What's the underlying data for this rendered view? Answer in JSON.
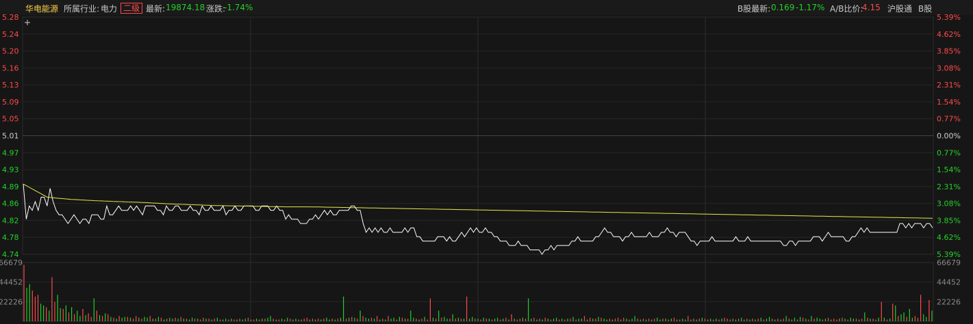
{
  "header": {
    "stock_name": "华电能源",
    "industry_label": "所属行业:",
    "industry_value": "电力",
    "level_badge": "二级",
    "latest_label": "最新:",
    "latest_value": "19874.18",
    "change_label": "涨跌:",
    "change_value": "-1.74%",
    "b_latest_label": "B股最新:",
    "b_latest_value": "0.169",
    "b_change_value": "-1.17%",
    "ab_ratio_label": "A/B比价:",
    "ab_ratio_value": "4.15",
    "hgt_label": "沪股通",
    "b_share_label": "B股"
  },
  "crosshair_icon": "plus-icon",
  "chart_data": {
    "type": "line",
    "title": "",
    "price_ticks": [
      "5.28",
      "5.24",
      "5.20",
      "5.16",
      "5.13",
      "5.09",
      "5.05",
      "5.01",
      "4.97",
      "4.93",
      "4.89",
      "4.86",
      "4.82",
      "4.78",
      "4.74"
    ],
    "pct_ticks": [
      "5.39%",
      "4.62%",
      "3.85%",
      "3.08%",
      "2.31%",
      "1.54%",
      "0.77%",
      "0.00%",
      "0.77%",
      "1.54%",
      "2.31%",
      "3.08%",
      "3.85%",
      "4.62%",
      "5.39%"
    ],
    "ylim": [
      4.74,
      5.28
    ],
    "reference_price": 5.01,
    "volume_ticks": [
      "66679",
      "44452",
      "22226"
    ],
    "volume_max": 66679,
    "colors": {
      "up": "#ff4a4a",
      "down": "#25d02a",
      "price_line": "#ffffff",
      "avg_line": "#e8e84a",
      "grid": "#2c2c2c"
    },
    "series": [
      {
        "role": "price",
        "values": [
          4.9,
          4.82,
          4.85,
          4.84,
          4.86,
          4.84,
          4.87,
          4.87,
          4.85,
          4.89,
          4.86,
          4.84,
          4.83,
          4.83,
          4.82,
          4.81,
          4.82,
          4.83,
          4.82,
          4.81,
          4.82,
          4.82,
          4.81,
          4.83,
          4.83,
          4.83,
          4.82,
          4.82,
          4.85,
          4.83,
          4.83,
          4.84,
          4.85,
          4.84,
          4.84,
          4.84,
          4.85,
          4.84,
          4.85,
          4.84,
          4.83,
          4.85,
          4.85,
          4.85,
          4.85,
          4.84,
          4.84,
          4.83,
          4.85,
          4.84,
          4.84,
          4.85,
          4.85,
          4.84,
          4.84,
          4.84,
          4.85,
          4.84,
          4.84,
          4.83,
          4.85,
          4.84,
          4.84,
          4.85,
          4.84,
          4.84,
          4.84,
          4.85,
          4.83,
          4.84,
          4.84,
          4.85,
          4.84,
          4.84,
          4.85,
          4.85,
          4.85,
          4.85,
          4.84,
          4.84,
          4.85,
          4.85,
          4.85,
          4.84,
          4.84,
          4.85,
          4.84,
          4.84,
          4.82,
          4.83,
          4.82,
          4.82,
          4.82,
          4.81,
          4.81,
          4.81,
          4.82,
          4.82,
          4.83,
          4.82,
          4.83,
          4.84,
          4.83,
          4.84,
          4.83,
          4.83,
          4.84,
          4.84,
          4.84,
          4.84,
          4.85,
          4.85,
          4.84,
          4.84,
          4.81,
          4.79,
          4.8,
          4.79,
          4.8,
          4.79,
          4.8,
          4.79,
          4.79,
          4.8,
          4.79,
          4.79,
          4.79,
          4.79,
          4.8,
          4.79,
          4.8,
          4.8,
          4.78,
          4.78,
          4.77,
          4.77,
          4.77,
          4.77,
          4.77,
          4.78,
          4.78,
          4.78,
          4.77,
          4.78,
          4.77,
          4.77,
          4.78,
          4.79,
          4.78,
          4.79,
          4.8,
          4.79,
          4.8,
          4.79,
          4.79,
          4.8,
          4.79,
          4.79,
          4.78,
          4.78,
          4.77,
          4.77,
          4.77,
          4.76,
          4.76,
          4.76,
          4.77,
          4.76,
          4.76,
          4.76,
          4.75,
          4.75,
          4.75,
          4.75,
          4.74,
          4.75,
          4.75,
          4.76,
          4.75,
          4.76,
          4.76,
          4.76,
          4.76,
          4.76,
          4.77,
          4.77,
          4.78,
          4.77,
          4.77,
          4.77,
          4.77,
          4.77,
          4.78,
          4.78,
          4.79,
          4.8,
          4.79,
          4.79,
          4.78,
          4.78,
          4.78,
          4.77,
          4.78,
          4.78,
          4.79,
          4.78,
          4.78,
          4.78,
          4.78,
          4.78,
          4.79,
          4.78,
          4.78,
          4.78,
          4.79,
          4.79,
          4.8,
          4.79,
          4.79,
          4.78,
          4.79,
          4.79,
          4.79,
          4.78,
          4.77,
          4.77,
          4.76,
          4.77,
          4.77,
          4.77,
          4.77,
          4.78,
          4.77,
          4.77,
          4.77,
          4.77,
          4.77,
          4.77,
          4.77,
          4.78,
          4.77,
          4.77,
          4.77,
          4.78,
          4.77,
          4.77,
          4.77,
          4.77,
          4.77,
          4.77,
          4.77,
          4.77,
          4.77,
          4.77,
          4.77,
          4.76,
          4.76,
          4.77,
          4.77,
          4.76,
          4.77,
          4.77,
          4.77,
          4.77,
          4.77,
          4.78,
          4.78,
          4.78,
          4.77,
          4.78,
          4.79,
          4.78,
          4.78,
          4.78,
          4.78,
          4.78,
          4.77,
          4.77,
          4.78,
          4.78,
          4.79,
          4.8,
          4.79,
          4.8,
          4.79,
          4.79,
          4.79,
          4.79,
          4.79,
          4.79,
          4.79,
          4.79,
          4.79,
          4.79,
          4.81,
          4.81,
          4.8,
          4.81,
          4.8,
          4.81,
          4.81,
          4.81,
          4.8,
          4.81,
          4.81,
          4.8
        ],
        "length_note": ""
      },
      {
        "role": "average",
        "values": [
          4.9,
          4.87,
          4.865,
          4.862,
          4.86,
          4.858,
          4.855,
          4.853,
          4.851,
          4.85,
          4.849,
          4.848,
          4.848,
          4.847,
          4.846,
          4.845,
          4.844,
          4.843,
          4.842,
          4.841,
          4.84,
          4.839,
          4.838,
          4.837,
          4.836,
          4.835,
          4.834,
          4.833,
          4.832,
          4.831,
          4.83,
          4.829,
          4.828,
          4.827,
          4.826,
          4.825,
          4.824,
          4.823,
          4.822
        ]
      }
    ],
    "volume": [
      64000,
      38000,
      42000,
      35000,
      28000,
      30000,
      20000,
      18000,
      16000,
      12000,
      50000,
      22000,
      30000,
      15000,
      14000,
      18000,
      10000,
      16000,
      8000,
      12000,
      6000,
      14000,
      7000,
      9000,
      5000,
      26000,
      12000,
      7000,
      6000,
      9000,
      8000,
      5000,
      4000,
      3000,
      6000,
      4000,
      5000,
      5000,
      4000,
      3000,
      6000,
      4000,
      3000,
      5000,
      4000,
      6000,
      3000,
      3000,
      5000,
      4000,
      2000,
      3000,
      4000,
      3000,
      4000,
      3000,
      5000,
      3000,
      3000,
      2000,
      4000,
      3000,
      3000,
      2000,
      4000,
      3000,
      3000,
      2000,
      3000,
      4000,
      2000,
      2000,
      3000,
      2000,
      3000,
      2000,
      2000,
      3000,
      2000,
      3000,
      4000,
      2000,
      2000,
      3000,
      2000,
      3000,
      3000,
      4000,
      6000,
      3000,
      2000,
      2000,
      3000,
      2000,
      4000,
      3000,
      2000,
      3000,
      2000,
      2000,
      3000,
      4000,
      2000,
      3000,
      2000,
      3000,
      2000,
      3000,
      4000,
      2000,
      3000,
      2000,
      3000,
      4000,
      28000,
      3000,
      4000,
      5000,
      4000,
      3000,
      12000,
      6000,
      4000,
      3000,
      4000,
      3000,
      6000,
      2000,
      3000,
      2000,
      6000,
      3000,
      4000,
      2000,
      5000,
      4000,
      3000,
      3000,
      12000,
      4000,
      3000,
      2000,
      3000,
      5000,
      2000,
      26000,
      4000,
      3000,
      12000,
      4000,
      5000,
      3000,
      3000,
      8000,
      3000,
      4000,
      3000,
      3000,
      28000,
      3000,
      5000,
      3000,
      3000,
      2000,
      4000,
      3000,
      3000,
      2000,
      3000,
      4000,
      2000,
      3000,
      4000,
      2000,
      8000,
      3000,
      2000,
      3000,
      4000,
      3000,
      26000,
      3000,
      4000,
      2000,
      3000,
      2000,
      4000,
      3000,
      2000,
      3000,
      4000,
      2000,
      3000,
      2000,
      3000,
      3000,
      5000,
      2000,
      3000,
      3000,
      6000,
      2000,
      4000,
      3000,
      3000,
      5000,
      4000,
      3000,
      2000,
      3000,
      2000,
      3000,
      4000,
      2000,
      4000,
      3000,
      2000,
      3000,
      6000,
      3000,
      2000,
      3000,
      2000,
      3000,
      2000,
      3000,
      4000,
      2000,
      3000,
      3000,
      2000,
      3000,
      4000,
      2000,
      2000,
      3000,
      2000,
      6000,
      2000,
      3000,
      2000,
      3000,
      4000,
      3000,
      2000,
      3000,
      2000,
      3000,
      2000,
      3000,
      4000,
      3000,
      2000,
      3000,
      2000,
      3000,
      4000,
      2000,
      3000,
      2000,
      3000,
      2000,
      3000,
      4000,
      2000,
      3000,
      5000,
      3000,
      2000,
      3000,
      2000,
      3000,
      6000,
      3000,
      2000,
      4000,
      2000,
      5000,
      4000,
      3000,
      2000,
      6000,
      3000,
      4000,
      3000,
      2000,
      3000,
      4000,
      2000,
      3000,
      2000,
      3000,
      4000,
      3000,
      2000,
      4000,
      3000,
      3000,
      2000,
      3000,
      10000,
      4000,
      3000,
      3000,
      2000,
      4000,
      22000,
      4000,
      2000,
      3000,
      20000,
      18000,
      6000,
      8000,
      10000,
      5000,
      14000,
      4000,
      6000,
      4000,
      30000,
      8000,
      5000,
      24000,
      12000
    ],
    "volume_up": [
      1,
      0,
      0,
      1,
      1,
      1,
      0,
      0,
      1,
      0,
      1,
      1,
      0,
      0,
      1,
      0,
      1,
      0,
      1,
      0,
      0,
      1,
      0,
      1,
      1,
      0,
      1,
      0,
      1,
      0,
      1,
      0,
      1,
      0,
      1,
      0,
      0,
      1,
      0,
      1,
      1,
      0,
      1,
      0,
      0,
      1,
      0,
      1,
      0,
      1,
      0,
      1,
      0,
      0,
      1,
      0,
      1,
      0,
      1,
      0,
      0,
      1,
      0,
      1,
      1,
      0,
      1,
      0,
      1,
      0,
      1,
      0,
      0,
      1,
      0,
      1,
      0,
      1,
      0,
      0,
      1,
      0,
      1,
      0,
      1,
      0,
      1,
      0,
      0,
      1,
      0,
      1,
      0,
      1,
      0,
      1,
      0,
      0,
      1,
      0,
      1,
      1,
      0,
      1,
      0,
      1,
      0,
      1,
      0,
      0,
      1,
      0,
      1,
      0,
      0,
      1,
      0,
      1,
      0,
      1,
      0,
      1,
      0,
      0,
      1,
      0,
      1,
      0,
      1,
      0,
      1,
      0,
      0,
      1,
      0,
      1,
      0,
      1,
      0,
      0,
      1,
      0,
      1,
      0,
      1,
      1,
      0,
      1,
      0,
      1,
      0,
      0,
      1,
      0,
      1,
      0,
      1,
      0,
      1,
      0,
      0,
      1,
      0,
      1,
      0,
      1,
      0,
      1,
      0,
      0,
      1,
      0,
      1,
      0,
      1,
      0,
      1,
      1,
      0,
      1,
      0,
      0,
      1,
      0,
      1,
      0,
      1,
      0,
      1,
      0,
      0,
      1,
      0,
      1,
      0,
      1,
      0,
      1,
      0,
      0,
      1,
      0,
      1,
      0,
      1,
      0,
      1,
      0,
      0,
      1,
      0,
      1,
      1,
      0,
      1,
      0,
      1,
      0,
      0,
      1,
      0,
      1,
      0,
      1,
      0,
      1,
      0,
      0,
      1,
      0,
      1,
      0,
      1,
      0,
      1,
      0,
      0,
      1,
      0,
      1,
      0,
      1,
      0,
      1,
      0,
      0,
      1,
      0,
      1,
      0,
      1,
      1,
      0,
      1,
      0,
      1,
      0,
      0,
      1,
      0,
      1,
      0,
      1,
      0,
      1,
      0,
      0,
      1,
      0,
      1,
      0,
      1,
      0,
      1,
      0,
      0,
      1,
      0,
      1,
      0,
      1,
      0,
      1,
      0,
      0,
      1,
      0,
      1,
      0,
      1,
      1,
      0,
      1,
      0,
      1,
      0,
      0,
      1,
      0,
      1,
      0,
      1,
      0,
      1,
      1,
      0,
      1,
      0,
      1,
      0,
      1,
      0,
      1,
      0,
      0
    ]
  }
}
